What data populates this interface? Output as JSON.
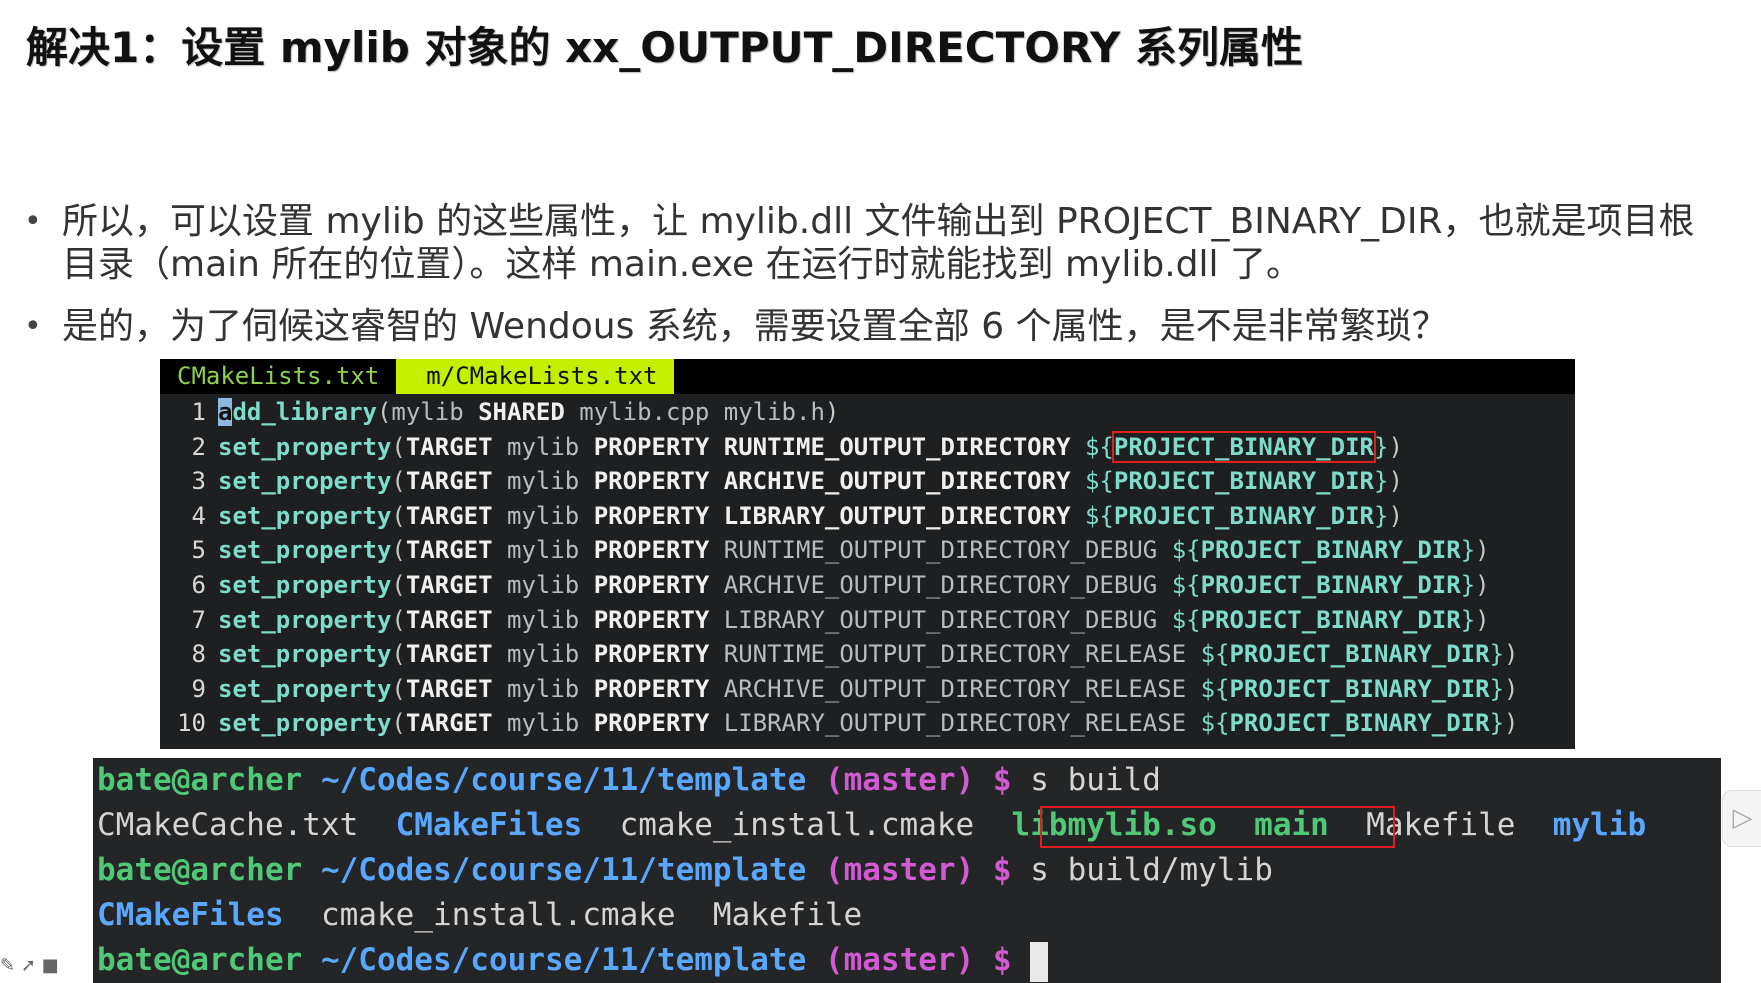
{
  "slide": {
    "title": "解决1：设置 mylib 对象的 xx_OUTPUT_DIRECTORY 系列属性",
    "bullets": [
      "所以，可以设置 mylib 的这些属性，让 mylib.dll 文件输出到 PROJECT_BINARY_DIR，也就是项目根目录（main 所在的位置）。这样 main.exe 在运行时就能找到 mylib.dll 了。",
      "是的，为了伺候这睿智的 Wendous 系统，需要设置全部 6 个属性，是不是非常繁琐？"
    ],
    "bullet_symbol": "•"
  },
  "editor": {
    "tabs": [
      "CMakeLists.txt",
      "m/CMakeLists.txt"
    ],
    "active_tab_index": 1,
    "line1": {
      "num": "1",
      "cursor_char": "a",
      "fn_rest": "dd_library",
      "open": "(",
      "arg1": "mylib",
      "kw": "SHARED",
      "args": "mylib.cpp mylib.h",
      "close": ")"
    },
    "set_fn": "set_property",
    "target_kw": "TARGET",
    "target_name": "mylib",
    "property_kw": "PROPERTY",
    "var_name": "PROJECT_BINARY_DIR",
    "var_open": "${",
    "var_close": "}",
    "paren_open": "(",
    "paren_close": ")",
    "props": [
      {
        "num": "2",
        "name": "RUNTIME_OUTPUT_DIRECTORY",
        "pad": " "
      },
      {
        "num": "3",
        "name": "ARCHIVE_OUTPUT_DIRECTORY",
        "pad": " "
      },
      {
        "num": "4",
        "name": "LIBRARY_OUTPUT_DIRECTORY",
        "pad": " "
      },
      {
        "num": "5",
        "name": "RUNTIME_OUTPUT_DIRECTORY_DEBUG",
        "pad": " "
      },
      {
        "num": "6",
        "name": "ARCHIVE_OUTPUT_DIRECTORY_DEBUG",
        "pad": " "
      },
      {
        "num": "7",
        "name": "LIBRARY_OUTPUT_DIRECTORY_DEBUG",
        "pad": " "
      },
      {
        "num": "8",
        "name": "RUNTIME_OUTPUT_DIRECTORY_RELEASE",
        "pad": " "
      },
      {
        "num": "9",
        "name": "ARCHIVE_OUTPUT_DIRECTORY_RELEASE",
        "pad": " "
      },
      {
        "num": "10",
        "name": "LIBRARY_OUTPUT_DIRECTORY_RELEASE",
        "pad": " "
      }
    ]
  },
  "terminal": {
    "prompt_user": "bate@archer",
    "prompt_path": "~/Codes/course/11/template",
    "prompt_branch": "(master)",
    "prompt_dollar": "$",
    "cmd1": "s build",
    "ls1": {
      "f1": "CMakeCache.txt",
      "d1": "CMakeFiles",
      "f2": "cmake_install.cmake",
      "e1": "libmylib.so",
      "e2": "main",
      "f3": "Makefile",
      "d2": "mylib"
    },
    "cmd2": "s build/mylib",
    "ls2": {
      "d1": "CMakeFiles",
      "f1": "cmake_install.cmake",
      "f2": "Makefile"
    }
  },
  "colors": {
    "editor_bg": "#1d1f21",
    "active_tab": "#c4f000",
    "identifier_teal": "#7fdbca",
    "highlight_box": "#e02020",
    "terminal_bg": "#232527",
    "prompt_green": "#50c878",
    "path_blue": "#5aa7ff",
    "branch_magenta": "#d25ad2"
  },
  "icons": [
    "eraser-icon",
    "pointer-icon",
    "camera-icon",
    "sidebar-handle-icon"
  ]
}
